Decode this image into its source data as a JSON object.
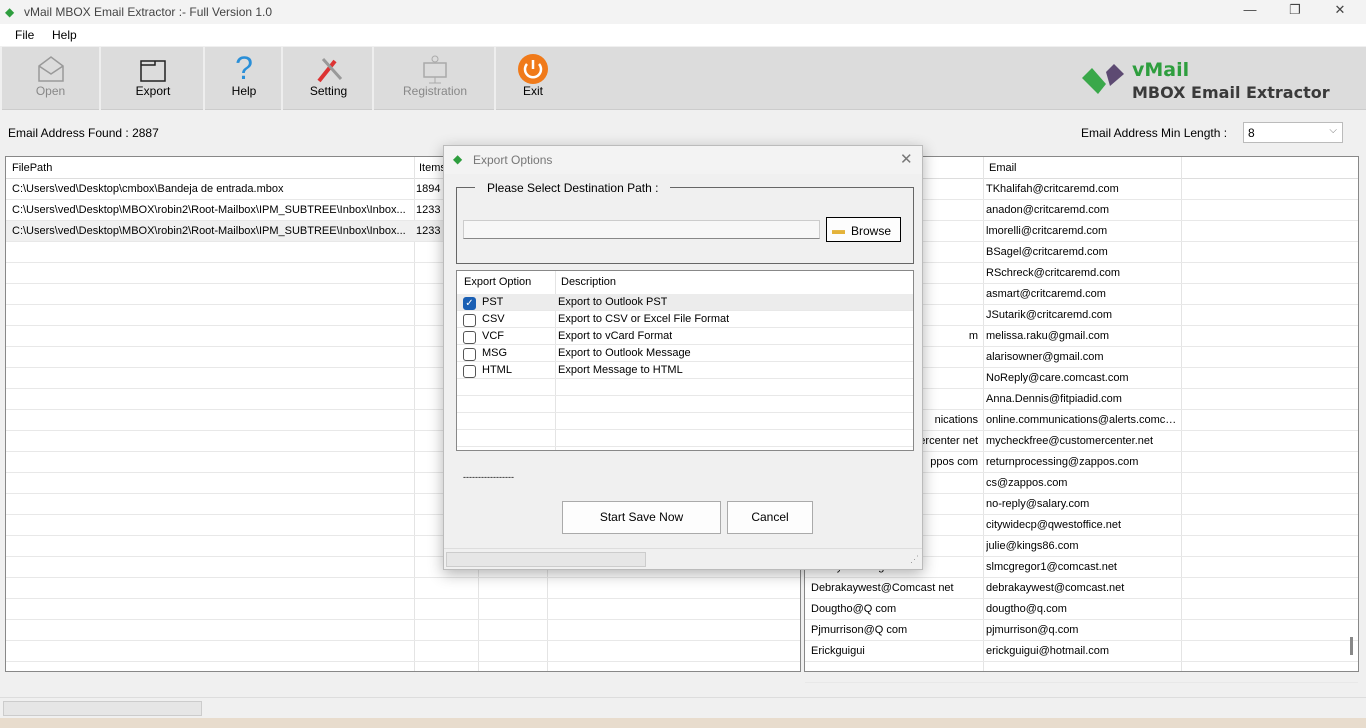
{
  "window": {
    "title": "vMail MBOX Email Extractor :- Full Version 1.0"
  },
  "menu": [
    "File",
    "Help"
  ],
  "toolbar": [
    {
      "label": "Open",
      "enabled": false
    },
    {
      "label": "Export",
      "enabled": true
    },
    {
      "label": "Help",
      "enabled": true
    },
    {
      "label": "Setting",
      "enabled": true
    },
    {
      "label": "Registration",
      "enabled": false
    },
    {
      "label": "Exit",
      "enabled": true
    }
  ],
  "logo": {
    "brand": "vMail",
    "product": "MBOX Email Extractor"
  },
  "status": {
    "found_label": "Email Address Found :",
    "found_count": "2887",
    "min_length_label": "Email Address Min Length :",
    "min_length_value": "8"
  },
  "files": {
    "columns": [
      "FilePath",
      "Items"
    ],
    "rows": [
      {
        "path": "C:\\Users\\ved\\Desktop\\cmbox\\Bandeja de entrada.mbox",
        "items": "1894"
      },
      {
        "path": "C:\\Users\\ved\\Desktop\\MBOX\\robin2\\Root-Mailbox\\IPM_SUBTREE\\Inbox\\Inbox...",
        "items": "1233"
      },
      {
        "path": "C:\\Users\\ved\\Desktop\\MBOX\\robin2\\Root-Mailbox\\IPM_SUBTREE\\Inbox\\Inbox...",
        "items": "1233"
      }
    ]
  },
  "emails": {
    "columns": [
      "",
      "Email"
    ],
    "rows": [
      {
        "name": "",
        "email": "TKhalifah@critcaremd.com"
      },
      {
        "name": "",
        "email": "anadon@critcaremd.com"
      },
      {
        "name": "",
        "email": "lmorelli@critcaremd.com"
      },
      {
        "name": "",
        "email": "BSagel@critcaremd.com"
      },
      {
        "name": "",
        "email": "RSchreck@critcaremd.com"
      },
      {
        "name": "",
        "email": "asmart@critcaremd.com"
      },
      {
        "name": "",
        "email": "JSutarik@critcaremd.com"
      },
      {
        "name": "m",
        "email": "melissa.raku@gmail.com"
      },
      {
        "name": "",
        "email": "alarisowner@gmail.com"
      },
      {
        "name": "",
        "email": "NoReply@care.comcast.com"
      },
      {
        "name": "",
        "email": "Anna.Dennis@fitpiadid.com"
      },
      {
        "name": "nications",
        "email": "online.communications@alerts.comca..."
      },
      {
        "name": "ercenter net",
        "email": "mycheckfree@customercenter.net"
      },
      {
        "name": "ppos com",
        "email": "returnprocessing@zappos.com"
      },
      {
        "name": "",
        "email": "cs@zappos.com"
      },
      {
        "name": "",
        "email": "no-reply@salary.com"
      },
      {
        "name": "",
        "email": "citywidecp@qwestoffice.net"
      },
      {
        "name": "",
        "email": "julie@kings86.com"
      },
      {
        "name": "Sandy McGregor",
        "email": "slmcgregor1@comcast.net"
      },
      {
        "name": "Debrakaywest@Comcast net",
        "email": "debrakaywest@comcast.net"
      },
      {
        "name": "Dougtho@Q com",
        "email": "dougtho@q.com"
      },
      {
        "name": "Pjmurrison@Q com",
        "email": "pjmurrison@q.com"
      },
      {
        "name": "Erickguigui",
        "email": "erickguigui@hotmail.com"
      }
    ]
  },
  "dialog": {
    "title": "Export Options",
    "group_label": "Please Select Destination Path :",
    "path_value": "",
    "browse": "Browse",
    "columns": [
      "Export Option",
      "Description"
    ],
    "options": [
      {
        "name": "PST",
        "desc": "Export to Outlook PST",
        "checked": true
      },
      {
        "name": "CSV",
        "desc": "Export to CSV or Excel File Format",
        "checked": false
      },
      {
        "name": "VCF",
        "desc": "Export to vCard Format",
        "checked": false
      },
      {
        "name": "MSG",
        "desc": "Export to Outlook Message",
        "checked": false
      },
      {
        "name": "HTML",
        "desc": "Export Message to HTML",
        "checked": false
      }
    ],
    "status_text": "-----------------",
    "start": "Start Save Now",
    "cancel": "Cancel"
  },
  "colors": {
    "brand_green": "#2e9e3e",
    "brand_purple": "#5d4a72",
    "exit_orange": "#f07a1a",
    "check_blue": "#1a5fb4"
  }
}
